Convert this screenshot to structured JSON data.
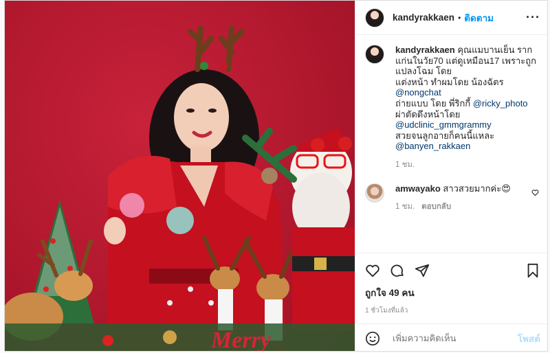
{
  "post": {
    "username": "kandyrakkaen",
    "follow_label": "ติดตาม",
    "separator": "•",
    "more_label": "···"
  },
  "caption": {
    "username": "kandyrakkaen",
    "lines": [
      "คุณแมบานเย็น ราก",
      "แก่นในวัย70 แต่ดูเหมือน17 เพราะถูก",
      "แปลงโฉม โดย",
      "แต่งหน้า ทำผมโดย น้องฉัตร"
    ],
    "mention1": "@nongchat",
    "line_photo": "ถ่ายแบบ โดย พี่ริกกี้",
    "mention2": "@ricky_photo",
    "line_clinic": "ผ่าตัดดึงหน้าโดย",
    "mention3": "@udclinic_gmmgrammy",
    "line_end": "สวยจนลูกอายก็คนนี้แหละ",
    "mention4": "@banyen_rakkaen",
    "time": "1 ชม."
  },
  "comment": {
    "username": "amwayako",
    "text": "สาวสวยมากค่ะ😍",
    "time": "1 ชม.",
    "reply_label": "ตอบกลับ"
  },
  "actions": {
    "likes": "ถูกใจ 49 คน",
    "posted_ago": "1 ชั่วโมงที่แล้ว"
  },
  "add_comment": {
    "placeholder": "เพิ่มความคิดเห็น",
    "post_label": "โพสต์",
    "emoji_icon": "smile-icon"
  }
}
